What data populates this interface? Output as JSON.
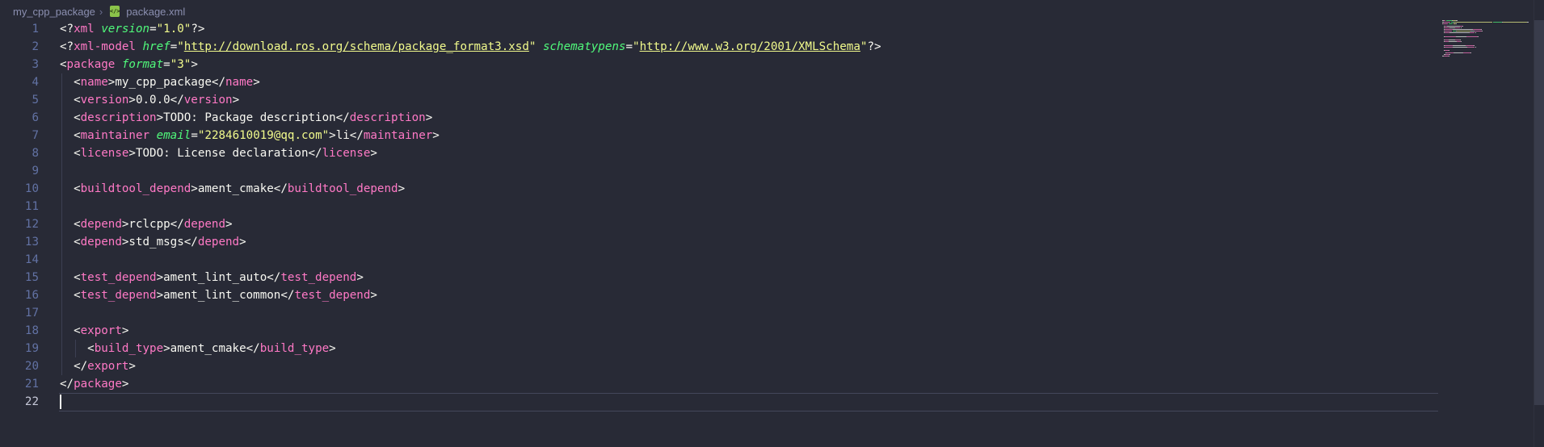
{
  "breadcrumb": {
    "folder": "my_cpp_package",
    "separator": "›",
    "file": "package.xml",
    "file_icon": "xml-file-icon"
  },
  "colors": {
    "background": "#282a36",
    "tag": "#ff79c6",
    "attribute": "#50fa7b",
    "string": "#f1fa8c",
    "text": "#f8f8f2",
    "line_number": "#6272a4"
  },
  "editor": {
    "cursor_line": 22,
    "lines": [
      {
        "n": "1",
        "code": [
          [
            "p",
            "<?"
          ],
          [
            "t",
            "xml"
          ],
          [
            "p",
            " "
          ],
          [
            "a",
            "version"
          ],
          [
            "p",
            "="
          ],
          [
            "s",
            "\"1.0\""
          ],
          [
            "p",
            "?>"
          ]
        ]
      },
      {
        "n": "2",
        "code": [
          [
            "p",
            "<?"
          ],
          [
            "t",
            "xml-model"
          ],
          [
            "p",
            " "
          ],
          [
            "a",
            "href"
          ],
          [
            "p",
            "="
          ],
          [
            "s",
            "\""
          ],
          [
            "u",
            "http://download.ros.org/schema/package_format3.xsd"
          ],
          [
            "s",
            "\""
          ],
          [
            "p",
            " "
          ],
          [
            "a",
            "schematypens"
          ],
          [
            "p",
            "="
          ],
          [
            "s",
            "\""
          ],
          [
            "u",
            "http://www.w3.org/2001/XMLSchema"
          ],
          [
            "s",
            "\""
          ],
          [
            "p",
            "?>"
          ]
        ]
      },
      {
        "n": "3",
        "code": [
          [
            "p",
            "<"
          ],
          [
            "t",
            "package"
          ],
          [
            "p",
            " "
          ],
          [
            "a",
            "format"
          ],
          [
            "p",
            "="
          ],
          [
            "s",
            "\"3\""
          ],
          [
            "p",
            ">"
          ]
        ]
      },
      {
        "n": "4",
        "code": [
          [
            "p",
            "  <"
          ],
          [
            "t",
            "name"
          ],
          [
            "p",
            ">my_cpp_package</"
          ],
          [
            "t",
            "name"
          ],
          [
            "p",
            ">"
          ]
        ]
      },
      {
        "n": "5",
        "code": [
          [
            "p",
            "  <"
          ],
          [
            "t",
            "version"
          ],
          [
            "p",
            ">0.0.0</"
          ],
          [
            "t",
            "version"
          ],
          [
            "p",
            ">"
          ]
        ]
      },
      {
        "n": "6",
        "code": [
          [
            "p",
            "  <"
          ],
          [
            "t",
            "description"
          ],
          [
            "p",
            ">TODO: Package description</"
          ],
          [
            "t",
            "description"
          ],
          [
            "p",
            ">"
          ]
        ]
      },
      {
        "n": "7",
        "code": [
          [
            "p",
            "  <"
          ],
          [
            "t",
            "maintainer"
          ],
          [
            "p",
            " "
          ],
          [
            "a",
            "email"
          ],
          [
            "p",
            "="
          ],
          [
            "s",
            "\"2284610019@qq.com\""
          ],
          [
            "p",
            ">li</"
          ],
          [
            "t",
            "maintainer"
          ],
          [
            "p",
            ">"
          ]
        ]
      },
      {
        "n": "8",
        "code": [
          [
            "p",
            "  <"
          ],
          [
            "t",
            "license"
          ],
          [
            "p",
            ">TODO: License declaration</"
          ],
          [
            "t",
            "license"
          ],
          [
            "p",
            ">"
          ]
        ]
      },
      {
        "n": "9",
        "code": []
      },
      {
        "n": "10",
        "code": [
          [
            "p",
            "  <"
          ],
          [
            "t",
            "buildtool_depend"
          ],
          [
            "p",
            ">ament_cmake</"
          ],
          [
            "t",
            "buildtool_depend"
          ],
          [
            "p",
            ">"
          ]
        ]
      },
      {
        "n": "11",
        "code": []
      },
      {
        "n": "12",
        "code": [
          [
            "p",
            "  <"
          ],
          [
            "t",
            "depend"
          ],
          [
            "p",
            ">rclcpp</"
          ],
          [
            "t",
            "depend"
          ],
          [
            "p",
            ">"
          ]
        ]
      },
      {
        "n": "13",
        "code": [
          [
            "p",
            "  <"
          ],
          [
            "t",
            "depend"
          ],
          [
            "p",
            ">std_msgs</"
          ],
          [
            "t",
            "depend"
          ],
          [
            "p",
            ">"
          ]
        ]
      },
      {
        "n": "14",
        "code": []
      },
      {
        "n": "15",
        "code": [
          [
            "p",
            "  <"
          ],
          [
            "t",
            "test_depend"
          ],
          [
            "p",
            ">ament_lint_auto</"
          ],
          [
            "t",
            "test_depend"
          ],
          [
            "p",
            ">"
          ]
        ]
      },
      {
        "n": "16",
        "code": [
          [
            "p",
            "  <"
          ],
          [
            "t",
            "test_depend"
          ],
          [
            "p",
            ">ament_lint_common</"
          ],
          [
            "t",
            "test_depend"
          ],
          [
            "p",
            ">"
          ]
        ]
      },
      {
        "n": "17",
        "code": []
      },
      {
        "n": "18",
        "code": [
          [
            "p",
            "  <"
          ],
          [
            "t",
            "export"
          ],
          [
            "p",
            ">"
          ]
        ]
      },
      {
        "n": "19",
        "code": [
          [
            "p",
            "    <"
          ],
          [
            "t",
            "build_type"
          ],
          [
            "p",
            ">ament_cmake</"
          ],
          [
            "t",
            "build_type"
          ],
          [
            "p",
            ">"
          ]
        ]
      },
      {
        "n": "20",
        "code": [
          [
            "p",
            "  </"
          ],
          [
            "t",
            "export"
          ],
          [
            "p",
            ">"
          ]
        ]
      },
      {
        "n": "21",
        "code": [
          [
            "p",
            "</"
          ],
          [
            "t",
            "package"
          ],
          [
            "p",
            ">"
          ]
        ]
      },
      {
        "n": "22",
        "code": []
      }
    ]
  }
}
